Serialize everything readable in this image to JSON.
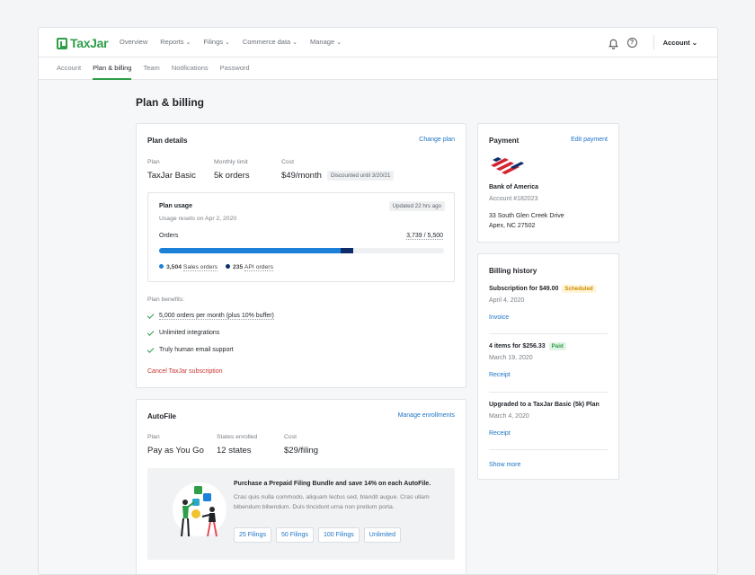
{
  "brand": {
    "name": "TaxJar",
    "accent": "#2e9e48",
    "link_color": "#1c74c7"
  },
  "topnav": {
    "items": [
      "Overview",
      "Reports",
      "Filings",
      "Commerce data",
      "Manage"
    ],
    "account": "Account",
    "icons": [
      "bell-icon",
      "help-icon"
    ]
  },
  "subnav": {
    "tabs": [
      "Account",
      "Plan & billing",
      "Team",
      "Notifications",
      "Password"
    ],
    "active_index": 1
  },
  "page": {
    "title": "Plan & billing"
  },
  "plan_details": {
    "title": "Plan details",
    "action": "Change plan",
    "plan_label": "Plan",
    "plan_value": "TaxJar Basic",
    "limit_label": "Monthly limit",
    "limit_value": "5k orders",
    "cost_label": "Cost",
    "cost_value": "$49/month",
    "discount_note": "Discounted until 3/20/21",
    "usage": {
      "title": "Plan usage",
      "updated": "Updated 22 hrs ago",
      "reset_note": "Usage resets on Apr 2, 2020",
      "orders_label": "Orders",
      "orders_count": "3,739 / 5,500",
      "used": 3739,
      "limit": 5500,
      "sales_count": "3,504",
      "sales_label": "Sales orders",
      "sales_value": 3504,
      "sales_color": "#1c80d8",
      "api_count": "235",
      "api_label": "API orders",
      "api_value": 235,
      "api_color": "#0d2d6b"
    },
    "benefits_label": "Plan benefits:",
    "benefits": [
      "5,000 orders per month (plus 10% buffer)",
      "Unlimited integrations",
      "Truly human email support"
    ],
    "cancel": "Cancel TaxJar subscription"
  },
  "autofile": {
    "title": "AutoFile",
    "action": "Manage enrollments",
    "plan_label": "Plan",
    "plan_value": "Pay as You Go",
    "states_label": "States enrolled",
    "states_value": "12 states",
    "cost_label": "Cost",
    "cost_value": "$29/filing",
    "promo": {
      "headline": "Purchase a Prepaid Filing Bundle and save 14% on each AutoFile.",
      "body": "Cras quis nulla commodo, aliquam lectus sed, blandit augue. Cras ullam bibendum bibendum. Duis tincidunt urna non pretium porta.",
      "options": [
        "25 Filings",
        "50 Filings",
        "100 Filings",
        "Unlimited"
      ]
    }
  },
  "payment": {
    "title": "Payment",
    "action": "Edit payment",
    "bank": "Bank of America",
    "account": "Account #182023",
    "address1": "33 South Glen Creek Drive",
    "address2": "Apex, NC 27502"
  },
  "billing_history": {
    "title": "Billing history",
    "items": [
      {
        "title": "Subscription for $49.00",
        "badge": "Scheduled",
        "date": "April 4, 2020",
        "link": "Invoice"
      },
      {
        "title": "4 items for $256.33",
        "badge": "Paid",
        "date": "March 19, 2020",
        "link": "Receipt"
      },
      {
        "title": "Upgraded to a TaxJar Basic (5k) Plan",
        "badge": "",
        "date": "March 4, 2020",
        "link": "Receipt"
      }
    ],
    "show_more": "Show more"
  }
}
